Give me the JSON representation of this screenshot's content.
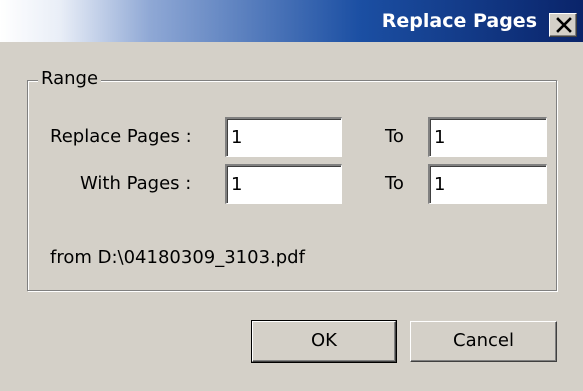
{
  "window": {
    "title": "Replace Pages",
    "close_icon": "close-icon"
  },
  "range": {
    "legend": "Range",
    "replace_pages_label": "Replace Pages :",
    "replace_from_value": "1",
    "replace_to_label": "To",
    "replace_to_value": "1",
    "with_pages_label": "With Pages :",
    "with_from_value": "1",
    "with_to_label": "To",
    "with_to_value": "1",
    "source_text": "from D:\\04180309_3103.pdf"
  },
  "buttons": {
    "ok_label": "OK",
    "cancel_label": "Cancel"
  },
  "colors": {
    "titlebar_start": "#ffffff",
    "titlebar_end": "#0a246a",
    "face": "#d4d0c8"
  }
}
